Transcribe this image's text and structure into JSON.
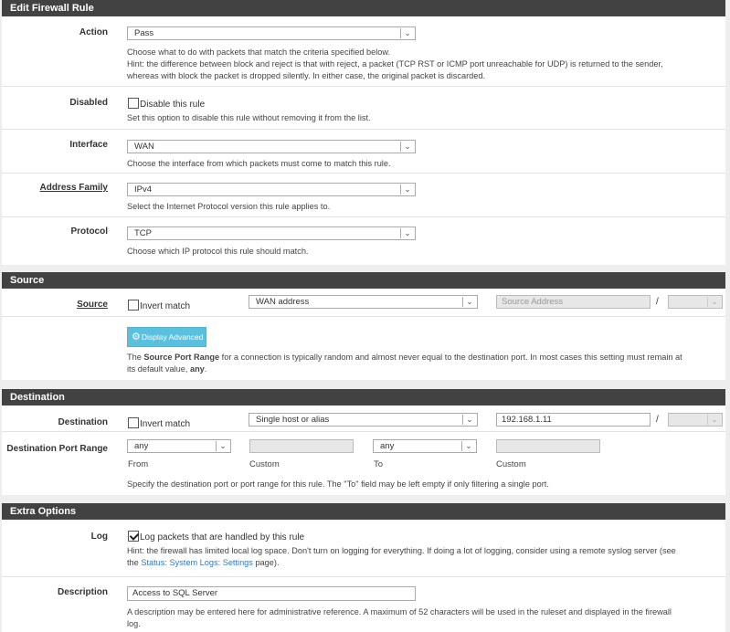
{
  "edit": {
    "heading": "Edit Firewall Rule",
    "action": {
      "label": "Action",
      "value": "Pass",
      "help1": "Choose what to do with packets that match the criteria specified below.",
      "help2": "Hint: the difference between block and reject is that with reject, a packet (TCP RST or ICMP port unreachable for UDP) is returned to the sender,",
      "help3": "whereas with block the packet is dropped silently. In either case, the original packet is discarded."
    },
    "disabled": {
      "label": "Disabled",
      "checkbox_label": "Disable this rule",
      "help": "Set this option to disable this rule without removing it from the list."
    },
    "interface": {
      "label": "Interface",
      "value": "WAN",
      "help": "Choose the interface from which packets must come to match this rule."
    },
    "address_family": {
      "label": "Address Family",
      "value": "IPv4",
      "help": "Select the Internet Protocol version this rule applies to."
    },
    "protocol": {
      "label": "Protocol",
      "value": "TCP",
      "help": "Choose which IP protocol this rule should match."
    }
  },
  "source": {
    "heading": "Source",
    "label": "Source",
    "invert_label": "Invert match",
    "type_value": "WAN address",
    "address_placeholder": "Source Address",
    "slash": "/",
    "advanced_button": "Display Advanced",
    "help_pre": "The ",
    "help_bold": "Source Port Range",
    "help_mid": " for a connection is typically random and almost never equal to the destination port. In most cases this setting must remain at",
    "help_line2_pre": "its default value, ",
    "help_line2_bold": "any",
    "help_line2_post": "."
  },
  "destination": {
    "heading": "Destination",
    "label": "Destination",
    "invert_label": "Invert match",
    "type_value": "Single host or alias",
    "address_value": "192.168.1.11",
    "slash": "/",
    "port_range_label": "Destination Port Range",
    "from_value": "any",
    "from_label": "From",
    "custom_label1": "Custom",
    "to_value": "any",
    "to_label": "To",
    "custom_label2": "Custom",
    "help": "Specify the destination port or port range for this rule. The \"To\" field may be left empty if only filtering a single port."
  },
  "extra": {
    "heading": "Extra Options",
    "log": {
      "label": "Log",
      "checkbox_label": "Log packets that are handled by this rule",
      "help1": "Hint: the firewall has limited local log space. Don't turn on logging for everything. If doing a lot of logging, consider using a remote syslog server (see",
      "help2_pre": "the ",
      "help2_link": "Status: System Logs: Settings",
      "help2_post": " page)."
    },
    "description": {
      "label": "Description",
      "value": "Access to SQL Server",
      "help1": "A description may be entered here for administrative reference. A maximum of 52 characters will be used in the ruleset and displayed in the firewall",
      "help2": "log."
    }
  },
  "icons": {
    "caret": "caret-down-icon",
    "gear": "gear-icon"
  },
  "colors": {
    "heading_bg": "#424242",
    "button_info": "#5bc0de",
    "link": "#337ab7"
  }
}
